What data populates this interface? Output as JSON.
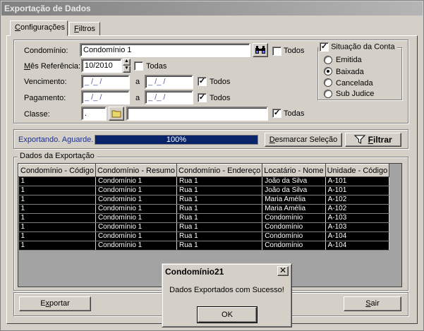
{
  "window": {
    "title": "Exportação de Dados"
  },
  "tabs": [
    {
      "label_prefix": "",
      "label_underline": "C",
      "label_rest": "onfigurações"
    },
    {
      "label_prefix": "",
      "label_underline": "F",
      "label_rest": "iltros"
    }
  ],
  "filters": {
    "condominio_label": "Condomínio:",
    "condominio_value": "Condomínio 1",
    "condominio_todos": "Todos",
    "mes_label_u": "M",
    "mes_label_rest": "ês Referência:",
    "mes_value": "10/2010",
    "mes_todas": "Todas",
    "vencimento_label": "Vencimento:",
    "vencimento_from": "_ /_ /",
    "vencimento_to": "_ /_ /",
    "vencimento_a": "a",
    "vencimento_todos": "Todos",
    "pagamento_label": "Pagamento:",
    "pagamento_from": "_ /_ /",
    "pagamento_to": "_ /_ /",
    "pagamento_a": "a",
    "pagamento_todos": "Todos",
    "classe_label": "Classe:",
    "classe_value": ".",
    "classe_todas": "Todas"
  },
  "situacao": {
    "title": "Situação da Conta",
    "options": [
      "Emitida",
      "Baixada",
      "Cancelada",
      "Sub Judice"
    ],
    "selected": "Baixada"
  },
  "status": {
    "text": "Exportando. Aguarde.",
    "progress_label": "100%",
    "progress_fraction": 1.0,
    "desmarcar_u": "D",
    "desmarcar_rest": "esmarcar Seleção",
    "filtrar_u": "F",
    "filtrar_rest": "iltrar"
  },
  "grid": {
    "title": "Dados da Exportação",
    "columns": [
      "Condomínio - Código",
      "Condomínio - Resumo",
      "Condomínio - Endereço",
      "Locatário - Nome",
      "Unidade - Código"
    ],
    "rows": [
      [
        "1",
        "Condomínio 1",
        "Rua 1",
        "João da Silva",
        "A-101"
      ],
      [
        "1",
        "Condomínio 1",
        "Rua 1",
        "João da Silva",
        "A-101"
      ],
      [
        "1",
        "Condomínio 1",
        "Rua 1",
        "Maria Amélia",
        "A-102"
      ],
      [
        "1",
        "Condomínio 1",
        "Rua 1",
        "Maria Amélia",
        "A-102"
      ],
      [
        "1",
        "Condomínio 1",
        "Rua 1",
        "Condomínio",
        "A-103"
      ],
      [
        "1",
        "Condomínio 1",
        "Rua 1",
        "Condomínio",
        "A-103"
      ],
      [
        "1",
        "Condomínio 1",
        "Rua 1",
        "Condomínio",
        "A-104"
      ],
      [
        "1",
        "Condomínio 1",
        "Rua 1",
        "Condomínio",
        "A-104"
      ]
    ]
  },
  "footer": {
    "exportar_pre": "E",
    "exportar_u": "x",
    "exportar_rest": "portar",
    "sair_u": "S",
    "sair_rest": "air"
  },
  "dialog": {
    "title": "Condomínio21",
    "close": "✕",
    "message": "Dados Exportados com Sucesso!",
    "ok": "OK"
  }
}
